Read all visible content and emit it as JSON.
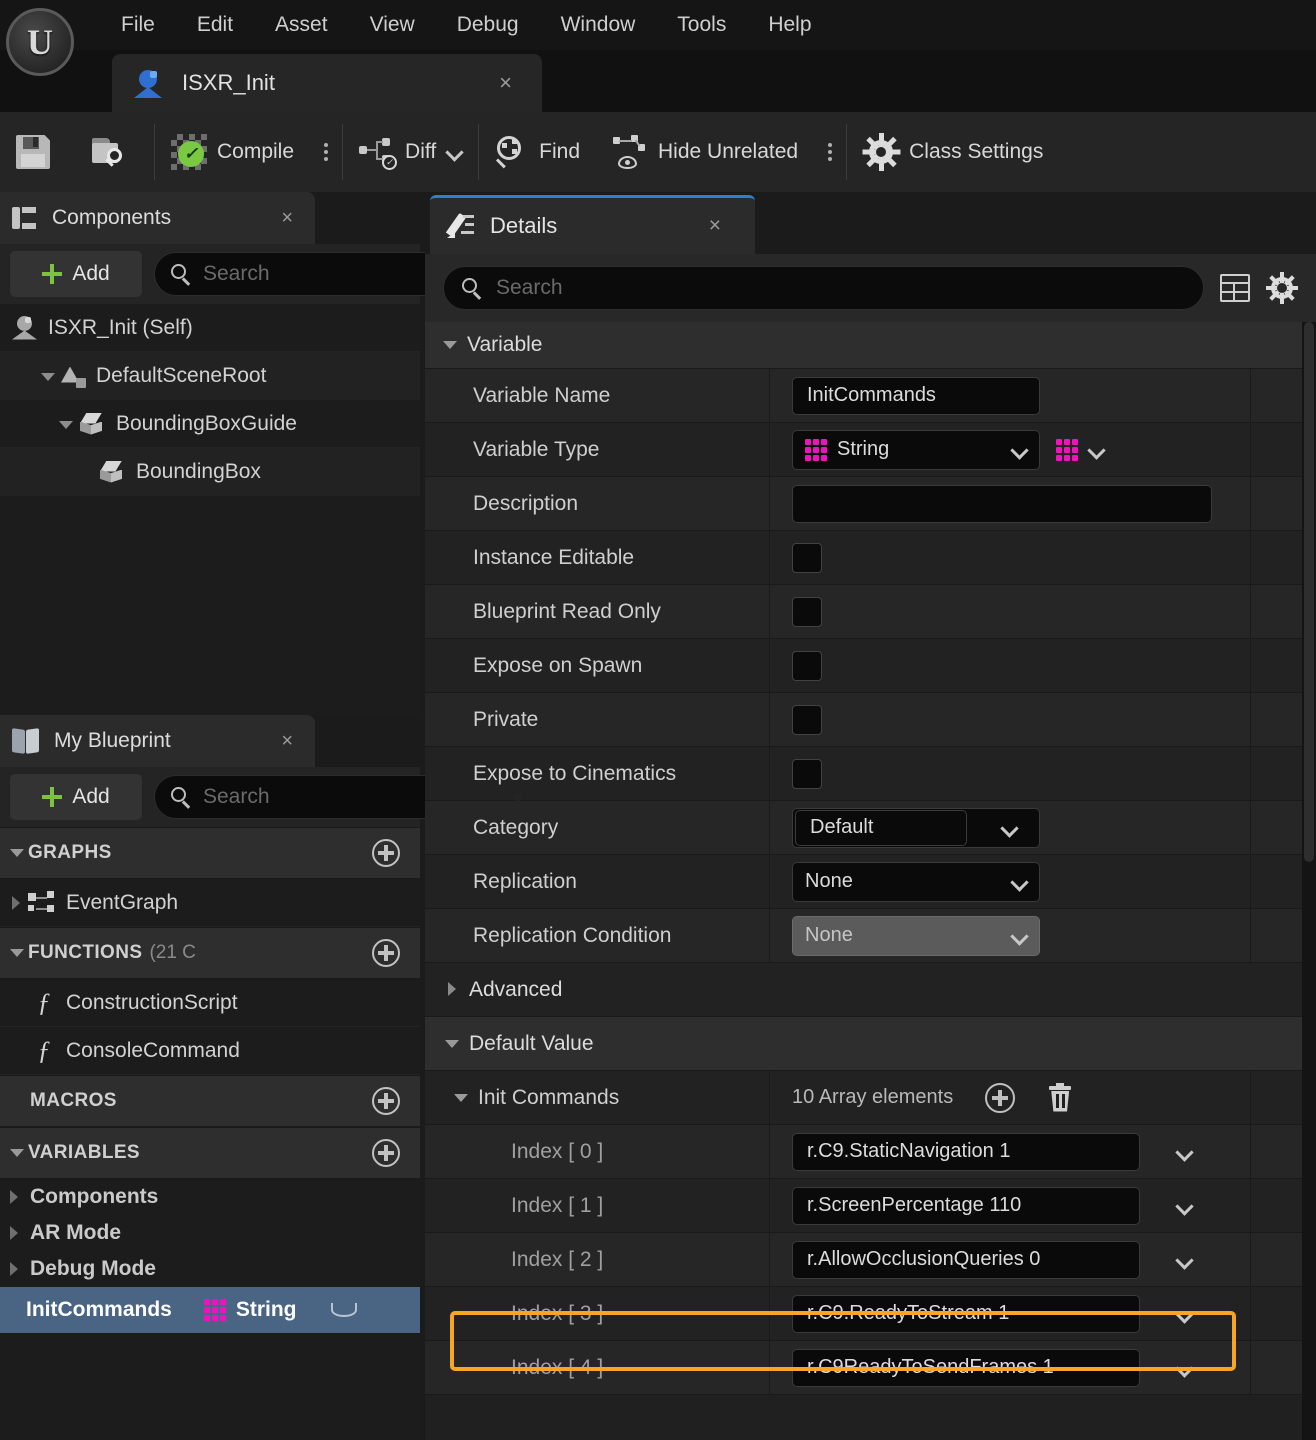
{
  "menubar": {
    "logo": "unreal-engine-logo",
    "items": [
      "File",
      "Edit",
      "Asset",
      "View",
      "Debug",
      "Window",
      "Tools",
      "Help"
    ]
  },
  "asset_tab": {
    "title": "ISXR_Init",
    "close": "×"
  },
  "toolbar": {
    "save_label": "",
    "browse_label": "",
    "compile_label": "Compile",
    "diff_label": "Diff",
    "find_label": "Find",
    "hide_unrelated_label": "Hide Unrelated",
    "class_settings_label": "Class Settings"
  },
  "components_panel": {
    "title": "Components",
    "close": "×",
    "add_label": "Add",
    "search_placeholder": "Search",
    "search_value": "",
    "tree": [
      {
        "label": "ISXR_Init (Self)",
        "icon": "actor-icon",
        "depth": 0,
        "expander": "none"
      },
      {
        "label": "DefaultSceneRoot",
        "icon": "scene-root-icon",
        "depth": 1,
        "expander": "down"
      },
      {
        "label": "BoundingBoxGuide",
        "icon": "cube-icon",
        "depth": 2,
        "expander": "down"
      },
      {
        "label": "BoundingBox",
        "icon": "cube-icon",
        "depth": 3,
        "expander": "none"
      }
    ]
  },
  "my_blueprint_panel": {
    "title": "My Blueprint",
    "close": "×",
    "add_label": "Add",
    "search_placeholder": "Search",
    "search_value": "",
    "sections": [
      {
        "header": "GRAPHS",
        "header_sub": "",
        "expander": "down",
        "has_add": true,
        "items": [
          {
            "label": "EventGraph",
            "icon": "event-graph-icon",
            "expander": "right"
          }
        ]
      },
      {
        "header": "FUNCTIONS",
        "header_sub": "(21 C",
        "expander": "down",
        "has_add": true,
        "items": [
          {
            "label": "ConstructionScript",
            "icon": "function-icon",
            "expander": "none"
          },
          {
            "label": "ConsoleCommand",
            "icon": "function-icon",
            "expander": "none"
          }
        ]
      },
      {
        "header": "MACROS",
        "header_sub": "",
        "expander": "none",
        "has_add": true,
        "items": []
      },
      {
        "header": "VARIABLES",
        "header_sub": "",
        "expander": "down",
        "has_add": true,
        "items": [
          {
            "label": "Components",
            "icon": "",
            "expander": "right"
          },
          {
            "label": "AR Mode",
            "icon": "",
            "expander": "right"
          },
          {
            "label": "Debug Mode",
            "icon": "",
            "expander": "right"
          }
        ]
      }
    ],
    "selected_variable": {
      "name": "InitCommands",
      "type": "String",
      "type_icon": "array-grid-icon",
      "visibility_icon": "eye-closed-icon",
      "highlight_color": "#4a6484"
    }
  },
  "details_panel": {
    "title": "Details",
    "close": "×",
    "active_tab_accent": "#2b7fd4",
    "search_placeholder": "Search",
    "search_value": "",
    "column_view_icon": "table-view-icon",
    "settings_icon": "gear-icon",
    "sections": [
      {
        "name": "Variable",
        "expanded": true
      },
      {
        "name": "Advanced",
        "expanded": false
      },
      {
        "name": "Default Value",
        "expanded": true
      }
    ],
    "variable_rows": [
      {
        "label": "Variable Name",
        "kind": "text",
        "value": "InitCommands"
      },
      {
        "label": "Variable Type",
        "kind": "type",
        "value": "String",
        "container_icon": "array-grid-icon"
      },
      {
        "label": "Description",
        "kind": "text_wide",
        "value": ""
      },
      {
        "label": "Instance Editable",
        "kind": "checkbox",
        "checked": false
      },
      {
        "label": "Blueprint Read Only",
        "kind": "checkbox",
        "checked": false
      },
      {
        "label": "Expose on Spawn",
        "kind": "checkbox",
        "checked": false
      },
      {
        "label": "Private",
        "kind": "checkbox",
        "checked": false
      },
      {
        "label": "Expose to Cinematics",
        "kind": "checkbox",
        "checked": false
      },
      {
        "label": "Category",
        "kind": "combo_text",
        "value": "Default"
      },
      {
        "label": "Replication",
        "kind": "combo",
        "value": "None"
      },
      {
        "label": "Replication Condition",
        "kind": "combo_disabled",
        "value": "None"
      }
    ],
    "array_property": {
      "label": "Init Commands",
      "element_count_text": "10 Array elements",
      "add_icon": "circle-plus-icon",
      "delete_icon": "trash-icon",
      "elements": [
        {
          "index_label": "Index [ 0 ]",
          "value": "r.C9.StaticNavigation 1",
          "highlighted": false
        },
        {
          "index_label": "Index [ 1 ]",
          "value": "r.ScreenPercentage 110",
          "highlighted": false
        },
        {
          "index_label": "Index [ 2 ]",
          "value": "r.AllowOcclusionQueries 0",
          "highlighted": false
        },
        {
          "index_label": "Index [ 3 ]",
          "value": "r.C9.ReadyToStream 1",
          "highlighted": true
        },
        {
          "index_label": "Index [ 4 ]",
          "value": "r.C9ReadyToSendFrames 1",
          "highlighted": false
        }
      ],
      "highlight_color": "#f5a623"
    }
  }
}
